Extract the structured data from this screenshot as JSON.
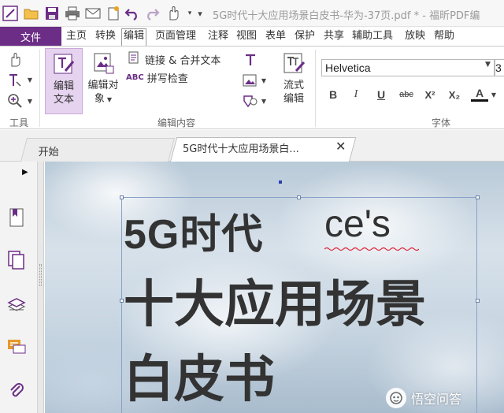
{
  "window": {
    "title": "5G时代十大应用场景白皮书-华为-37页.pdf * - 福昕PDF编"
  },
  "quick_access": {
    "icons": [
      "app-logo-icon",
      "open-folder-icon",
      "save-icon",
      "print-icon",
      "email-icon",
      "new-doc-icon",
      "undo-icon",
      "redo-icon",
      "hand-tool-icon",
      "customize-icon"
    ]
  },
  "ribbon_tabs": {
    "file": "文件",
    "items": [
      "主页",
      "转换",
      "编辑",
      "页面管理",
      "注释",
      "视图",
      "表单",
      "保护",
      "共享",
      "辅助工具",
      "放映",
      "帮助"
    ],
    "active": "编辑"
  },
  "ribbon": {
    "tools_group": "工具",
    "edit_content_group": "编辑内容",
    "font_group": "字体",
    "edit_text": [
      "编辑",
      "文本"
    ],
    "edit_object": [
      "编辑对",
      "象"
    ],
    "link_merge": "链接 & 合并文本",
    "spell_check": "拼写检查",
    "flow_edit": [
      "流式",
      "编辑"
    ],
    "font_name": "Helvetica",
    "font_size": "3",
    "format_buttons": [
      "B",
      "I",
      "U",
      "abc",
      "X²",
      "X₂",
      "A"
    ]
  },
  "doc_tabs": {
    "start": "开始",
    "current": "5G时代十大应用场景白...",
    "close": "✕"
  },
  "document": {
    "line1": "5G时代",
    "line1_suffix": "ce's",
    "line2": "十大应用场景",
    "line3": "白皮书"
  },
  "watermark": {
    "text": "悟空问答"
  },
  "colors": {
    "accent": "#6b2d86",
    "selection": "#8aa0c8"
  }
}
